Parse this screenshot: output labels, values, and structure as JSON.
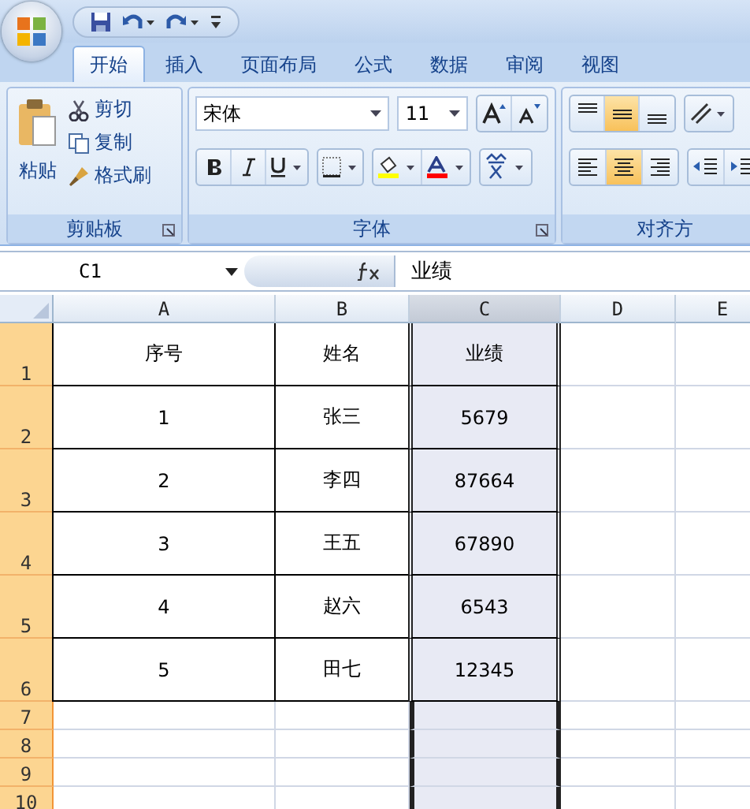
{
  "tabs": [
    {
      "label": "开始",
      "selected": true
    },
    {
      "label": "插入",
      "selected": false
    },
    {
      "label": "页面布局",
      "selected": false
    },
    {
      "label": "公式",
      "selected": false
    },
    {
      "label": "数据",
      "selected": false
    },
    {
      "label": "审阅",
      "selected": false
    },
    {
      "label": "视图",
      "selected": false
    }
  ],
  "clipboard": {
    "paste": "粘贴",
    "cut": "剪切",
    "copy": "复制",
    "format_painter": "格式刷",
    "group": "剪贴板"
  },
  "font": {
    "name": "宋体",
    "size": "11",
    "group": "字体"
  },
  "alignment": {
    "group": "对齐方",
    "vertical": [
      {
        "selected": false
      },
      {
        "selected": true
      },
      {
        "selected": false
      }
    ],
    "horizontal": [
      {
        "selected": false
      },
      {
        "selected": true
      },
      {
        "selected": false
      }
    ]
  },
  "name_box": "C1",
  "formula": "业绩",
  "columns": [
    {
      "label": "A",
      "selected": false
    },
    {
      "label": "B",
      "selected": false
    },
    {
      "label": "C",
      "selected": true
    },
    {
      "label": "D",
      "selected": false
    },
    {
      "label": "E",
      "selected": false
    }
  ],
  "rows": [
    {
      "header": "1",
      "cells": [
        "序号",
        "姓名",
        "业绩"
      ]
    },
    {
      "header": "2",
      "cells": [
        "1",
        "张三",
        "5679"
      ]
    },
    {
      "header": "3",
      "cells": [
        "2",
        "李四",
        "87664"
      ]
    },
    {
      "header": "4",
      "cells": [
        "3",
        "王五",
        "67890"
      ]
    },
    {
      "header": "5",
      "cells": [
        "4",
        "赵六",
        "6543"
      ]
    },
    {
      "header": "6",
      "cells": [
        "5",
        "田七",
        "12345"
      ]
    },
    {
      "header": "7",
      "cells": []
    },
    {
      "header": "8",
      "cells": []
    },
    {
      "header": "9",
      "cells": []
    },
    {
      "header": "10",
      "cells": []
    }
  ]
}
